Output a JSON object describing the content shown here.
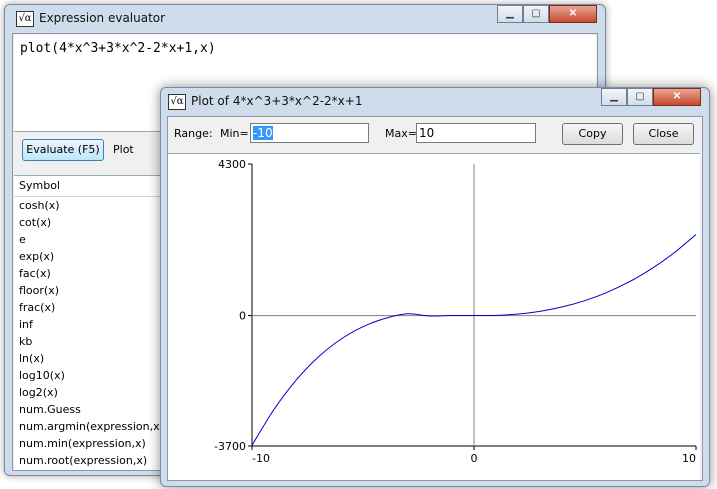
{
  "evaluator": {
    "title": "Expression evaluator",
    "expression": "plot(4*x^3+3*x^2-2*x+1,x)",
    "evaluate_label": "Evaluate (F5)",
    "plot_tab_label": "Plot",
    "symbol_header": "Symbol",
    "symbols": [
      "cosh(x)",
      "cot(x)",
      "e",
      "exp(x)",
      "fac(x)",
      "floor(x)",
      "frac(x)",
      "inf",
      "kb",
      "ln(x)",
      "log10(x)",
      "log2(x)",
      "num.Guess",
      "num.argmin(expression,x)",
      "num.min(expression,x)",
      "num.root(expression,x)"
    ]
  },
  "plot": {
    "title": "Plot of 4*x^3+3*x^2-2*x+1",
    "range_label": "Range:",
    "min_label": "Min=",
    "min_value": "-10",
    "max_label": "Max=",
    "max_value": "10",
    "copy_label": "Copy",
    "close_label": "Close",
    "y_ticks": [
      "4300",
      "0",
      "-3700"
    ],
    "x_ticks": [
      "-10",
      "0",
      "10"
    ]
  },
  "icons": {
    "app": "sqrt-alpha-icon",
    "minimize": "minimize-icon",
    "maximize": "maximize-icon",
    "close": "close-icon"
  },
  "colors": {
    "curve": "#0000cc",
    "frame": "#cfdcec"
  },
  "chart_data": {
    "type": "line",
    "title": "",
    "xlabel": "",
    "ylabel": "",
    "xlim": [
      -10,
      10
    ],
    "ylim": [
      -3700,
      4300
    ],
    "x_ticks": [
      -10,
      0,
      10
    ],
    "y_ticks": [
      -3700,
      0,
      4300
    ],
    "series": [
      {
        "x": [
          -10,
          -9,
          -8,
          -7,
          -6,
          -5,
          -4,
          -3,
          -2,
          -1,
          0,
          1,
          2,
          3,
          4,
          5,
          6,
          7,
          8,
          9,
          10
        ],
        "y": [
          -3679,
          -2654,
          -1823,
          -1168,
          -671,
          -314,
          -79,
          52,
          -11,
          2,
          1,
          6,
          45,
          124,
          249,
          426,
          661,
          960,
          1329,
          1774,
          2301
        ]
      }
    ],
    "grid": false
  }
}
